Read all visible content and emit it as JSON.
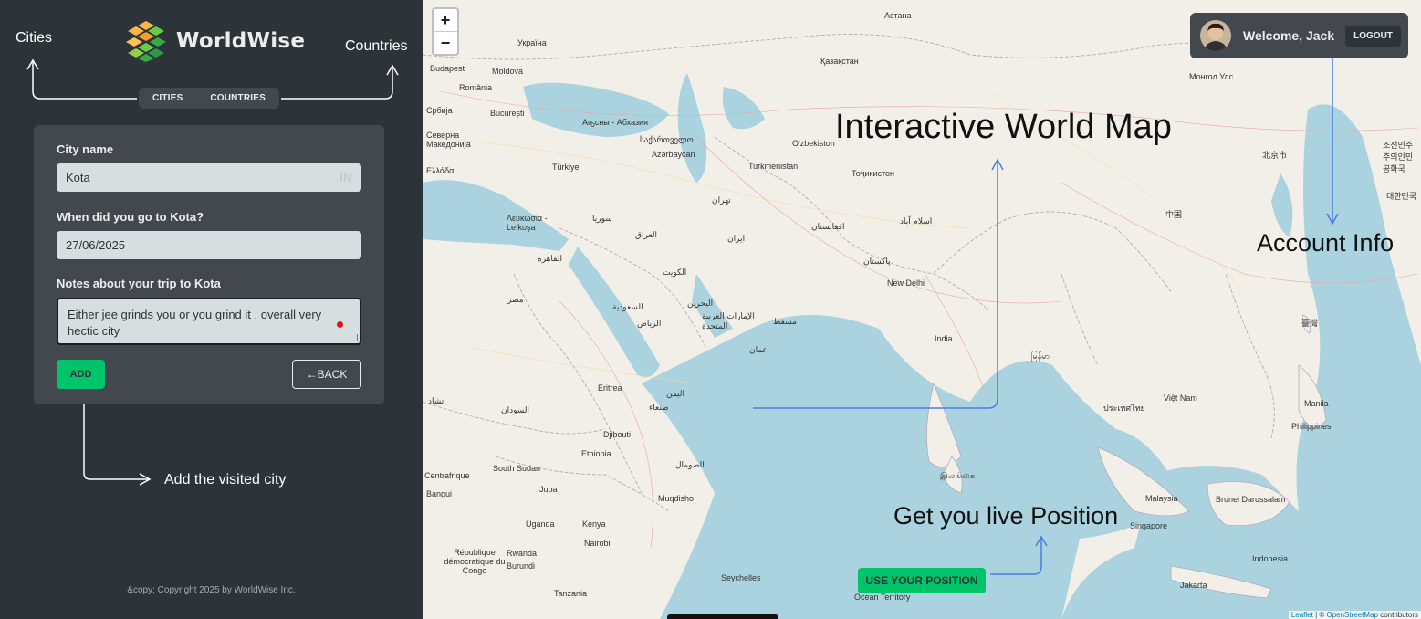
{
  "app": {
    "name": "WorldWise"
  },
  "annotations": {
    "cities": "Cities",
    "countries": "Countries",
    "add_city": "Add the visited city",
    "map_title": "Interactive World Map",
    "account_info": "Account Info",
    "live_position": "Get you live Position"
  },
  "nav": {
    "cities": "CITIES",
    "countries": "COUNTRIES"
  },
  "form": {
    "city_label": "City name",
    "city_value": "Kota",
    "country_code": "IN",
    "date_label": "When did you go to Kota?",
    "date_value": "27/06/2025",
    "notes_label": "Notes about your trip to Kota",
    "notes_value": "Either jee grinds you or you grind it , overall very hectic city",
    "add_label": "ADD",
    "back_label": "←BACK"
  },
  "footer": {
    "copyright": "&copy; Copyright 2025 by WorldWise Inc."
  },
  "map": {
    "zoom_in": "+",
    "zoom_out": "−",
    "use_position": "USE YOUR POSITION",
    "attribution_leaflet": "Leaflet",
    "attribution_sep": " | © ",
    "attribution_osm": "OpenStreetMap",
    "attribution_tail": " contributors",
    "labels": {
      "astana": "Астана",
      "kazakhstan": "Қазақстан",
      "ukraine": "Україна",
      "budapest": "Budapest",
      "moldova": "Moldova",
      "romania": "România",
      "bucuresti": "București",
      "srbija": "Србија",
      "makedonija": "Северна Македонија",
      "ellada": "Ελλάδα",
      "turkiye": "Türkiye",
      "abkhazia": "Аҧсны - Абхазия",
      "georgia": "საქართველო",
      "azerbaycan": "Azərbaycan",
      "uzbekiston": "O'zbekiston",
      "turkmenistan": "Turkmenistan",
      "tojikiston": "Тоҷикистон",
      "lefkosa": "Λευκωσία - Lefkoşa",
      "suriya": "سوريا",
      "iraq": "العراق",
      "iran": "ایران",
      "tehran": "تهران",
      "afghanistan": "افغانستان",
      "islamabad": "اسلام آباد",
      "pakistan": "پاکستان",
      "newdelhi": "New Delhi",
      "india": "India",
      "misr": "مصر",
      "cairo": "القاهرة",
      "kuwait": "الكويت",
      "saudi": "السعودية",
      "riyadh": "الرياض",
      "bahrain": "البحرين",
      "uae": "الإمارات العربية المتحدة",
      "muscat": "مسقط",
      "oman": "عمان",
      "yemen": "اليمن",
      "sanaa": "صنعاء",
      "eritrea": "Eritrea",
      "sudan": "السودان",
      "djibouti": "Djibouti",
      "ethiopia": "Ethiopia",
      "somalia": "الصومال",
      "mogadishu": "Muqdisho",
      "southsudan": "South Sudan",
      "juba": "Juba",
      "uganda": "Uganda",
      "kenya": "Kenya",
      "nairobi": "Nairobi",
      "rwanda": "Rwanda",
      "burundi": "Burundi",
      "congo": "République démocratique du Congo",
      "tanzania": "Tanzania",
      "seychelles": "Seychelles",
      "oceanterritory": "Ocean Territory",
      "srilanka": "இலங்கை",
      "myanmar": "မြန်မာ",
      "zhongguo": "中国",
      "beijing": "北京市",
      "taiwan": "臺灣",
      "korea": "대한민국",
      "dprk": "조선민주주의인민공화국",
      "mongolia": "Монгол Улс",
      "thailand": "ประเทศไทย",
      "vietnam": "Việt Nam",
      "malaysia": "Malaysia",
      "singapore": "Singapore",
      "brunei": "Brunei Darussalam",
      "philippines": "Philippines",
      "manila": "Manila",
      "indonesia": "Indonesia",
      "jakarta": "Jakarta",
      "bangui": "Bangui",
      "centrafrique": "Centrafrique",
      "tchad": "تشاد"
    }
  },
  "user": {
    "welcome": "Welcome, Jack",
    "logout": "LOGOUT"
  }
}
